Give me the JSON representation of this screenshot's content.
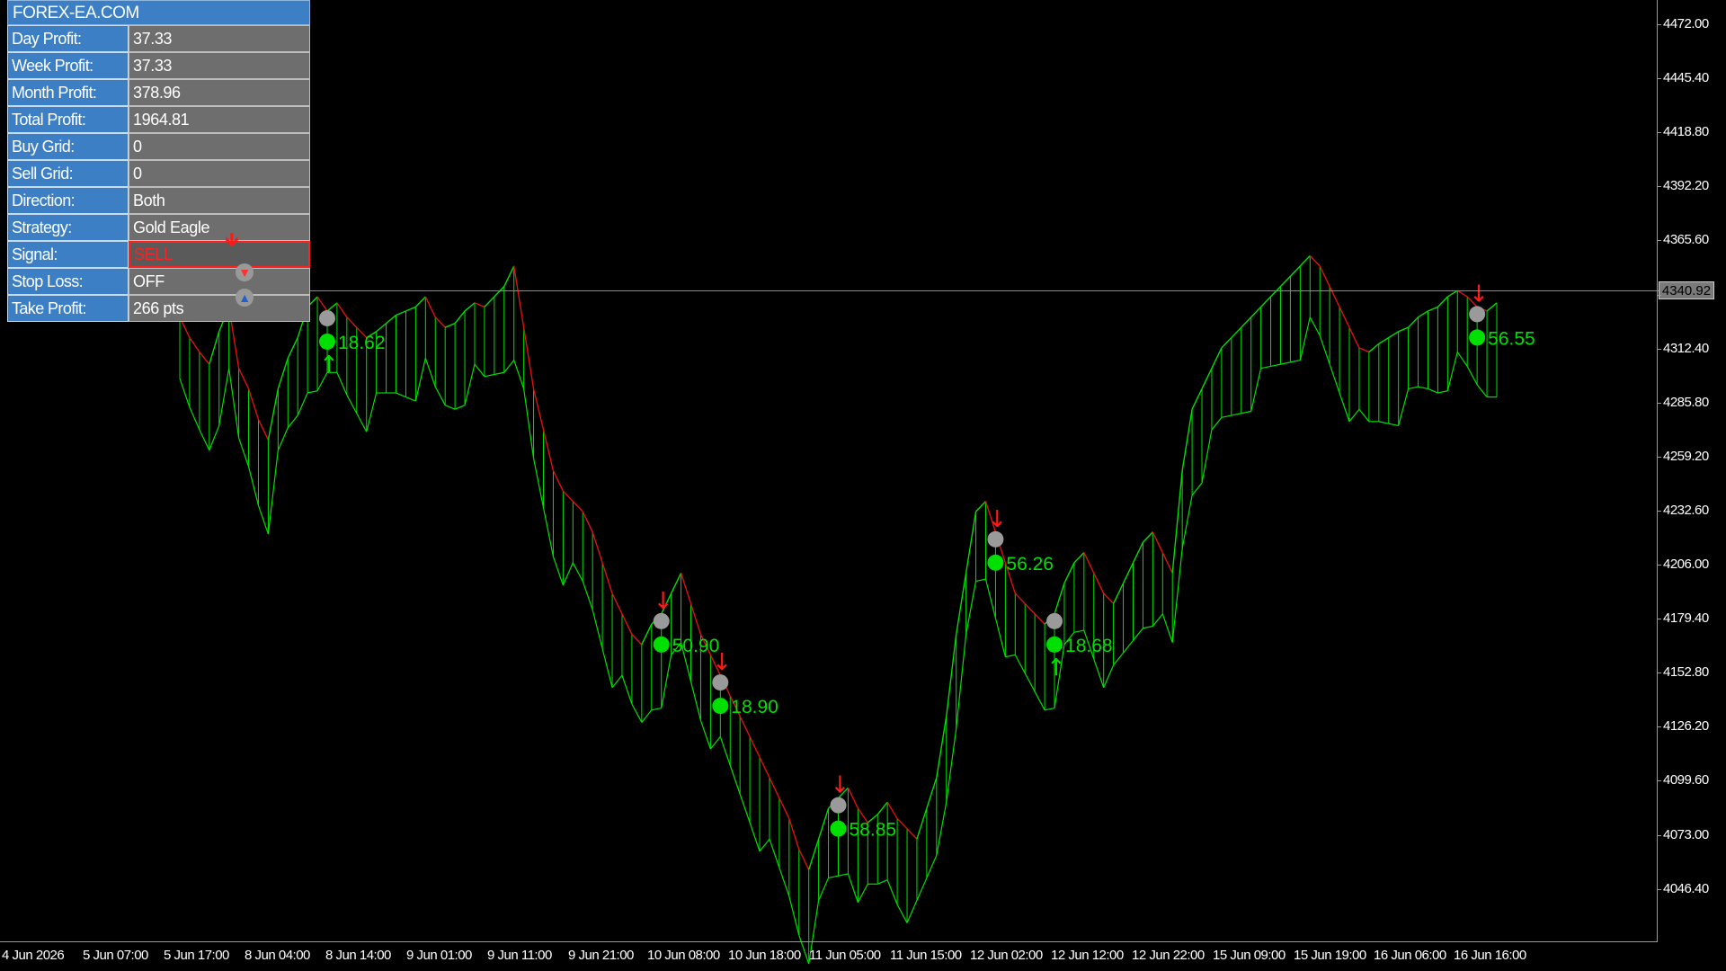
{
  "panel": {
    "title": "FOREX-EA.COM",
    "rows": [
      {
        "label": "Day Profit:",
        "value": "37.33"
      },
      {
        "label": "Week Profit:",
        "value": "37.33"
      },
      {
        "label": "Month Profit:",
        "value": "378.96"
      },
      {
        "label": "Total Profit:",
        "value": "1964.81"
      },
      {
        "label": "Buy Grid:",
        "value": "0"
      },
      {
        "label": "Sell Grid:",
        "value": "0"
      },
      {
        "label": "Direction:",
        "value": "Both"
      },
      {
        "label": "Strategy:",
        "value": "Gold Eagle"
      },
      {
        "label": "Signal:",
        "value": "SELL"
      },
      {
        "label": "Stop Loss:",
        "value": "OFF"
      },
      {
        "label": "Take Profit:",
        "value": "266 pts"
      }
    ]
  },
  "chart": {
    "current_price": "4340.92",
    "colors": {
      "bull": "#00e000",
      "bear": "#e01010",
      "background": "#000000",
      "axis": "#9a9a9a"
    },
    "trade_labels": [
      "18.62",
      "50.90",
      "18.90",
      "58.85",
      "56.26",
      "18.68",
      "56.55"
    ]
  },
  "chart_data": {
    "type": "line",
    "ylim": [
      4030,
      4490
    ],
    "y_ticks": [
      "4472.00",
      "4445.40",
      "4418.80",
      "4392.20",
      "4365.60",
      "4340.92",
      "4312.40",
      "4285.80",
      "4259.20",
      "4232.60",
      "4206.00",
      "4179.40",
      "4152.80",
      "4126.20",
      "4099.60",
      "4073.00",
      "4046.40"
    ],
    "x_ticks": [
      "4 Jun 2026",
      "5 Jun 07:00",
      "5 Jun 17:00",
      "8 Jun 04:00",
      "8 Jun 14:00",
      "9 Jun 01:00",
      "9 Jun 11:00",
      "9 Jun 21:00",
      "10 Jun 08:00",
      "10 Jun 18:00",
      "11 Jun 05:00",
      "11 Jun 15:00",
      "12 Jun 02:00",
      "12 Jun 12:00",
      "12 Jun 22:00",
      "15 Jun 09:00",
      "15 Jun 19:00",
      "16 Jun 06:00",
      "16 Jun 16:00"
    ],
    "series": [
      {
        "values": [
          4335,
          4325,
          4318,
          4312,
          4328,
          4340,
          4310,
          4300,
          4285,
          4275,
          4300,
          4315,
          4325,
          4340,
          4345,
          4338,
          4342,
          4335,
          4330,
          4325,
          4328,
          4332,
          4336,
          4338,
          4340,
          4345,
          4335,
          4330,
          4332,
          4338,
          4342,
          4340,
          4345,
          4350,
          4360,
          4330,
          4300,
          4280,
          4260,
          4250,
          4245,
          4240,
          4230,
          4215,
          4200,
          4190,
          4180,
          4175,
          4185,
          4190,
          4200,
          4210,
          4195,
          4180,
          4170,
          4160,
          4150,
          4140,
          4130,
          4120,
          4110,
          4100,
          4090,
          4075,
          4065,
          4080,
          4095,
          4100,
          4105,
          4095,
          4088,
          4092,
          4098,
          4090,
          4085,
          4080,
          4095,
          4110,
          4140,
          4180,
          4210,
          4240,
          4245,
          4230,
          4215,
          4200,
          4195,
          4190,
          4185,
          4190,
          4205,
          4215,
          4220,
          4210,
          4200,
          4195,
          4205,
          4215,
          4225,
          4230,
          4220,
          4210,
          4260,
          4290,
          4300,
          4310,
          4320,
          4325,
          4330,
          4335,
          4340,
          4345,
          4350,
          4355,
          4360,
          4365,
          4360,
          4350,
          4340,
          4330,
          4320,
          4318,
          4322,
          4325,
          4328,
          4330,
          4335,
          4338,
          4340,
          4345,
          4348,
          4345,
          4340,
          4338,
          4342
        ]
      }
    ]
  }
}
